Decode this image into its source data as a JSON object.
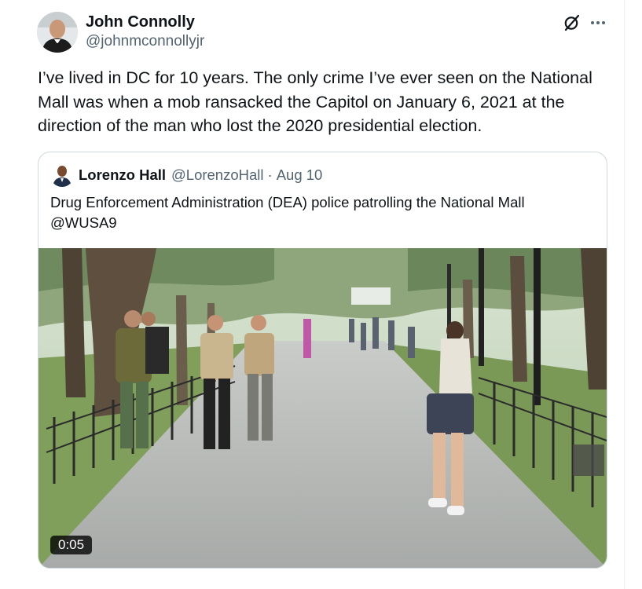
{
  "tweet": {
    "author": {
      "name": "John Connolly",
      "handle": "@johnmconnollyjr"
    },
    "text": "I’ve lived in DC for 10 years. The only crime I’ve ever seen on the National\nMall was when a mob ransacked the Capitol on January 6, 2021 at the\ndirection of the man who lost the 2020 presidential election.",
    "icons": [
      "grok-icon",
      "more-icon"
    ]
  },
  "quote": {
    "author": {
      "name": "Lorenzo Hall",
      "handle": "@LorenzoHall",
      "separator": "·",
      "date": "Aug 10"
    },
    "text": "Drug Enforcement Administration (DEA) police patrolling the National Mall\n@WUSA9",
    "video": {
      "duration": "0:05"
    }
  },
  "colors": {
    "text": "#0f1419",
    "secondary": "#536471",
    "border": "#cfd9de"
  }
}
